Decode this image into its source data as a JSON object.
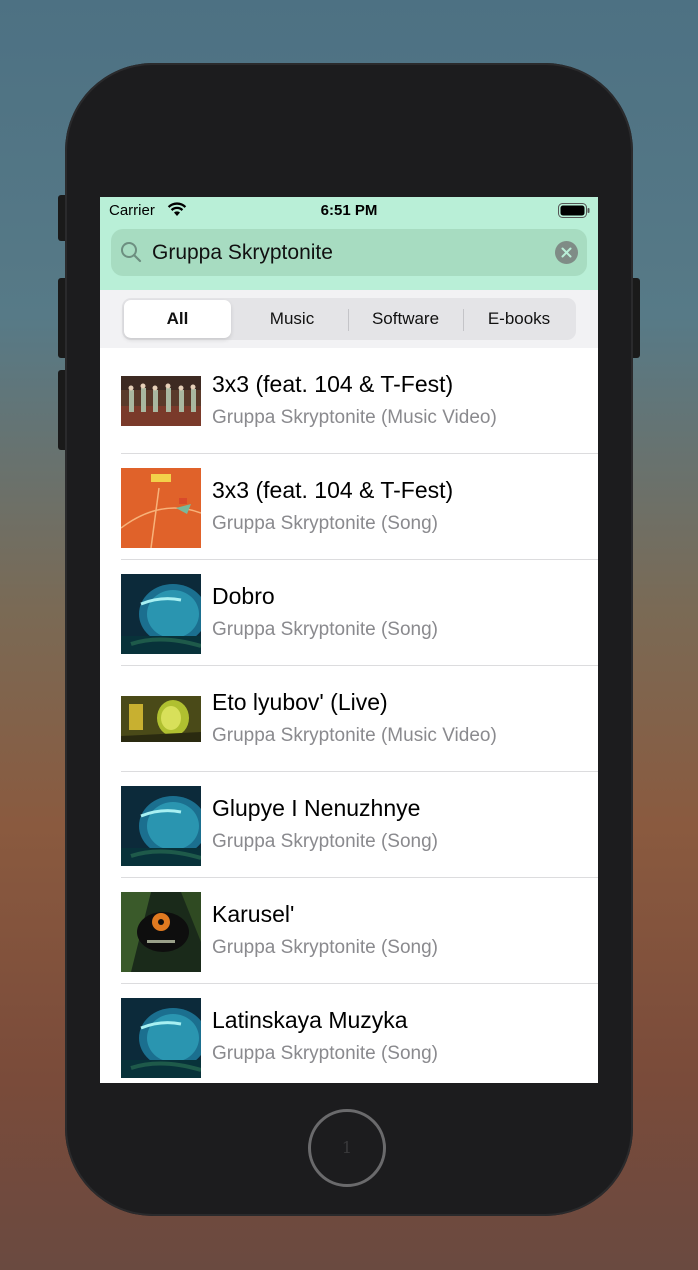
{
  "status_bar": {
    "carrier": "Carrier",
    "time": "6:51 PM"
  },
  "search": {
    "query": "Gruppa Skryptonite"
  },
  "segments": [
    {
      "label": "All",
      "selected": true
    },
    {
      "label": "Music",
      "selected": false
    },
    {
      "label": "Software",
      "selected": false
    },
    {
      "label": "E-books",
      "selected": false
    }
  ],
  "results": [
    {
      "title": "3x3 (feat. 104 & T-Fest)",
      "subtitle": "Gruppa Skryptonite (Music Video)",
      "art": "video-dancers"
    },
    {
      "title": "3x3 (feat. 104 & T-Fest)",
      "subtitle": "Gruppa Skryptonite (Song)",
      "art": "orange-court"
    },
    {
      "title": "Dobro",
      "subtitle": "Gruppa Skryptonite (Song)",
      "art": "blue-tower"
    },
    {
      "title": "Eto lyubov' (Live)",
      "subtitle": "Gruppa Skryptonite (Music Video)",
      "art": "video-yellow"
    },
    {
      "title": "Glupye I Nenuzhnye",
      "subtitle": "Gruppa Skryptonite (Song)",
      "art": "blue-tower"
    },
    {
      "title": "Karusel'",
      "subtitle": "Gruppa Skryptonite (Song)",
      "art": "green-vinyl"
    },
    {
      "title": "Latinskaya Muzyka",
      "subtitle": "Gruppa Skryptonite (Song)",
      "art": "blue-tower"
    }
  ],
  "home_button": {
    "label": "1"
  },
  "colors": {
    "header": "#b9efd7",
    "search_field": "#a7dcc1",
    "subtitle": "#8a8a8e"
  }
}
